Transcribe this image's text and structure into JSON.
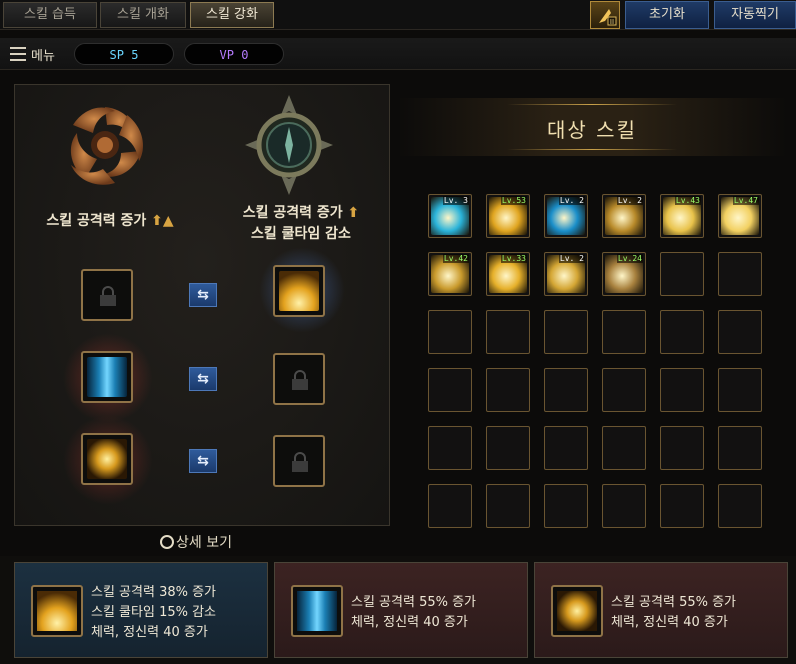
{
  "tabs": [
    {
      "label": "스킬 습득",
      "active": false
    },
    {
      "label": "스킬 개화",
      "active": false
    },
    {
      "label": "스킬 강화",
      "active": true
    }
  ],
  "header_buttons": {
    "reset": "초기화",
    "auto": "자동찍기"
  },
  "menu": {
    "label": "메뉴",
    "sp": "SP 5",
    "vp": "VP 0"
  },
  "enhance": {
    "left_title": "스킬 공격력 증가",
    "right_title_line1": "스킬 공격력 증가",
    "right_title_line2": "스킬 쿨타임 감소",
    "rows": [
      {
        "left": "locked",
        "right": "gold-burst"
      },
      {
        "left": "blue-pillar",
        "right": "locked"
      },
      {
        "left": "gold-sun",
        "right": "locked"
      }
    ],
    "detail_link": "상세 보기"
  },
  "target": {
    "title": "대상 스킬",
    "skills": [
      {
        "level": "Lv. 3",
        "color": "#2ab3d9",
        "lvclass": "w"
      },
      {
        "level": "Lv.53",
        "color": "#e0a520",
        "lvclass": "g"
      },
      {
        "level": "Lv. 2",
        "color": "#1a8ec9",
        "lvclass": "w"
      },
      {
        "level": "Lv. 2",
        "color": "#b88a2a",
        "lvclass": "w"
      },
      {
        "level": "Lv.43",
        "color": "#e8c24a",
        "lvclass": "g"
      },
      {
        "level": "Lv.47",
        "color": "#f2d061",
        "lvclass": "g"
      },
      {
        "level": "Lv.42",
        "color": "#c99a2c",
        "lvclass": "g"
      },
      {
        "level": "Lv.33",
        "color": "#e6b02a",
        "lvclass": "g"
      },
      {
        "level": "Lv. 2",
        "color": "#d4a634",
        "lvclass": "w"
      },
      {
        "level": "Lv.24",
        "color": "#a8813e",
        "lvclass": "g"
      }
    ]
  },
  "bonus_cards": [
    {
      "line1": "스킬 공격력 38% 증가",
      "line2": "스킬 쿨타임 15% 감소",
      "line3": "체력, 정신력 40 증가",
      "icon": "gold-burst"
    },
    {
      "line1": "스킬 공격력 55% 증가",
      "line2": "체력, 정신력 40 증가",
      "line3": "",
      "icon": "blue-pillar"
    },
    {
      "line1": "스킬 공격력 55% 증가",
      "line2": "체력, 정신력 40 증가",
      "line3": "",
      "icon": "gold-sun"
    }
  ]
}
